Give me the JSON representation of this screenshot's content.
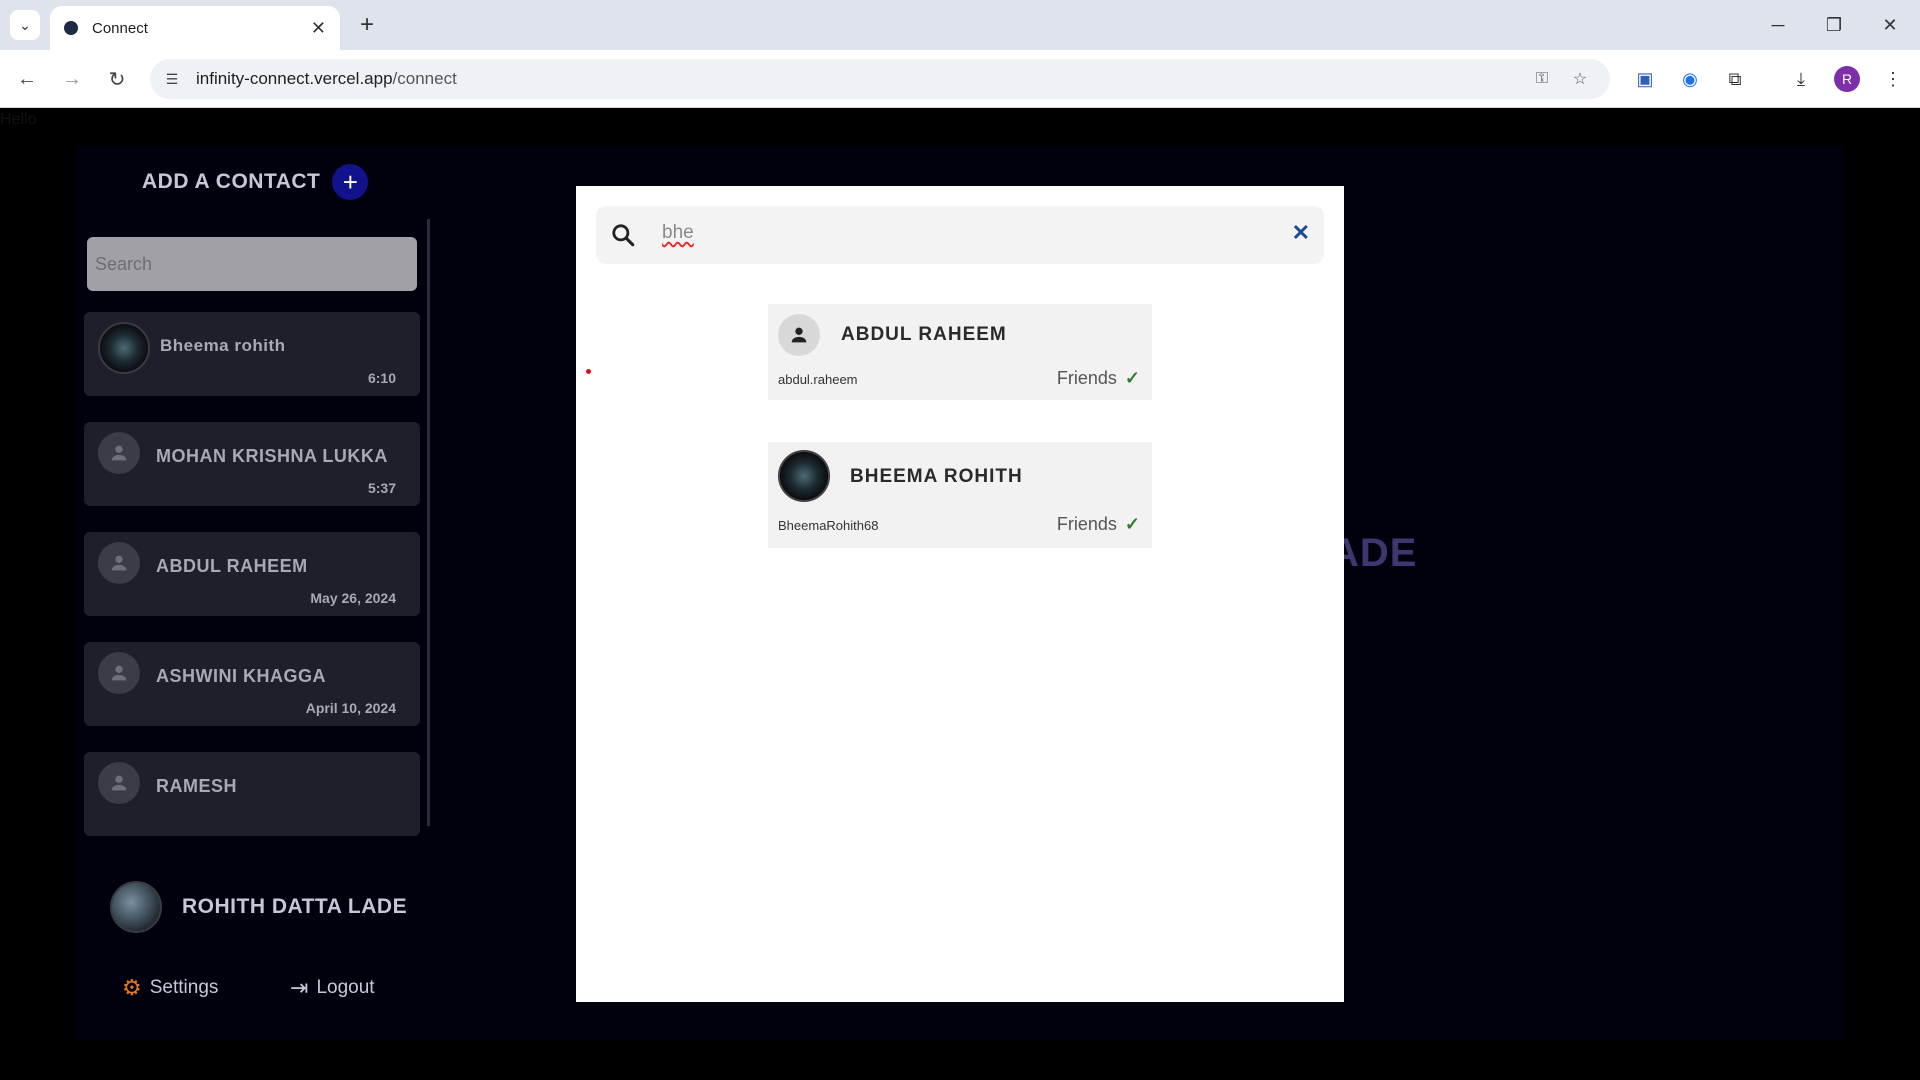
{
  "browser": {
    "tab_title": "Connect",
    "url_host": "infinity-connect.vercel.app",
    "url_path": "/connect",
    "profile_initial": "R"
  },
  "page": {
    "hello_text": "Hello"
  },
  "sidebar": {
    "add_contact_label": "ADD A CONTACT",
    "add_button_glyph": "+",
    "search_placeholder": "Search",
    "contacts": [
      {
        "name": "Bheema rohith",
        "time": "6:10",
        "avatar": "photo"
      },
      {
        "name": "MOHAN KRISHNA LUKKA",
        "time": "5:37",
        "avatar": "default"
      },
      {
        "name": "ABDUL RAHEEM",
        "time": "May 26, 2024",
        "avatar": "default"
      },
      {
        "name": "ASHWINI KHAGGA",
        "time": "April 10, 2024",
        "avatar": "default"
      },
      {
        "name": "RAMESH",
        "time": "",
        "avatar": "default"
      }
    ],
    "me_name": "ROHITH DATTA LADE",
    "settings_label": "Settings",
    "logout_label": "Logout"
  },
  "background_title": "ADE",
  "modal": {
    "search_value": "bhe",
    "close_glyph": "✕",
    "results": [
      {
        "name": "ABDUL RAHEEM",
        "handle": "abdul.raheem",
        "status": "Friends",
        "avatar": "default"
      },
      {
        "name": "BHEEMA ROHITH",
        "handle": "BheemaRohith68",
        "status": "Friends",
        "avatar": "photo"
      }
    ]
  },
  "colors": {
    "accent_blue": "#12128c",
    "app_bg": "#01010e",
    "card_bg": "#1f1f2b",
    "friends_check": "#2e7d32"
  }
}
